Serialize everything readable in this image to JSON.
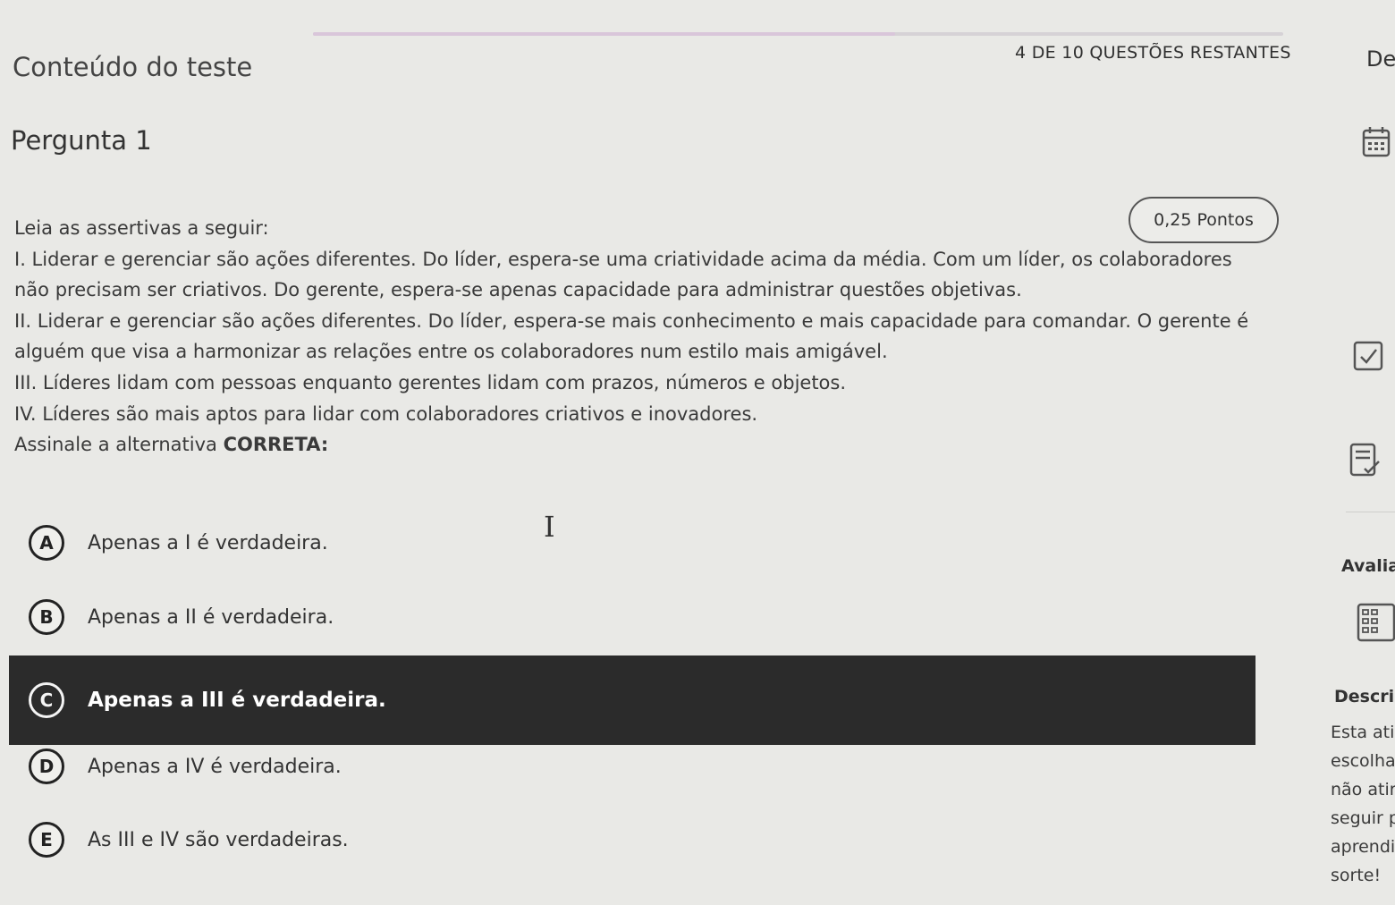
{
  "header": {
    "content_title": "Conteúdo do teste",
    "remaining": "4 DE 10 QUESTÕES RESTANTES",
    "side_title": "De"
  },
  "progress": {
    "completed_fraction": 0.6
  },
  "question": {
    "title": "Pergunta 1",
    "points": "0,25 Pontos",
    "lines": [
      "Leia as assertivas a seguir:",
      "I. Liderar e gerenciar são ações diferentes. Do líder, espera-se uma criatividade acima da média. Com um líder, os colaboradores",
      "não precisam ser criativos. Do gerente, espera-se apenas capacidade para administrar questões objetivas.",
      "II. Liderar e gerenciar são ações diferentes. Do líder, espera-se mais conhecimento e mais capacidade para comandar. O gerente é",
      "alguém que visa a harmonizar as relações entre os colaboradores num estilo mais amigável.",
      "III. Líderes lidam com pessoas enquanto gerentes lidam com prazos, números e objetos.",
      "IV. Líderes são mais aptos para lidar com colaboradores criativos e inovadores."
    ],
    "instruction_prefix": "Assinale a alternativa ",
    "instruction_emphasis": "CORRETA:",
    "options": [
      {
        "letter": "A",
        "text": "Apenas a I é verdadeira."
      },
      {
        "letter": "B",
        "text": "Apenas a II é verdadeira."
      },
      {
        "letter": "C",
        "text": "Apenas a III é verdadeira."
      },
      {
        "letter": "D",
        "text": "Apenas a IV é verdadeira."
      },
      {
        "letter": "E",
        "text": "As III e IV são verdadeiras."
      }
    ],
    "selected": "C"
  },
  "sidebar": {
    "evaluation_label": "Avalia",
    "description_label": "Descri",
    "description_text": "Esta ati\nescolha\nnão atir\nseguir p\naprendiz\nsorte!"
  },
  "icons": [
    "calendar-icon",
    "checkbox-icon",
    "checklist-icon",
    "grid-icon",
    "text-cursor-icon"
  ]
}
